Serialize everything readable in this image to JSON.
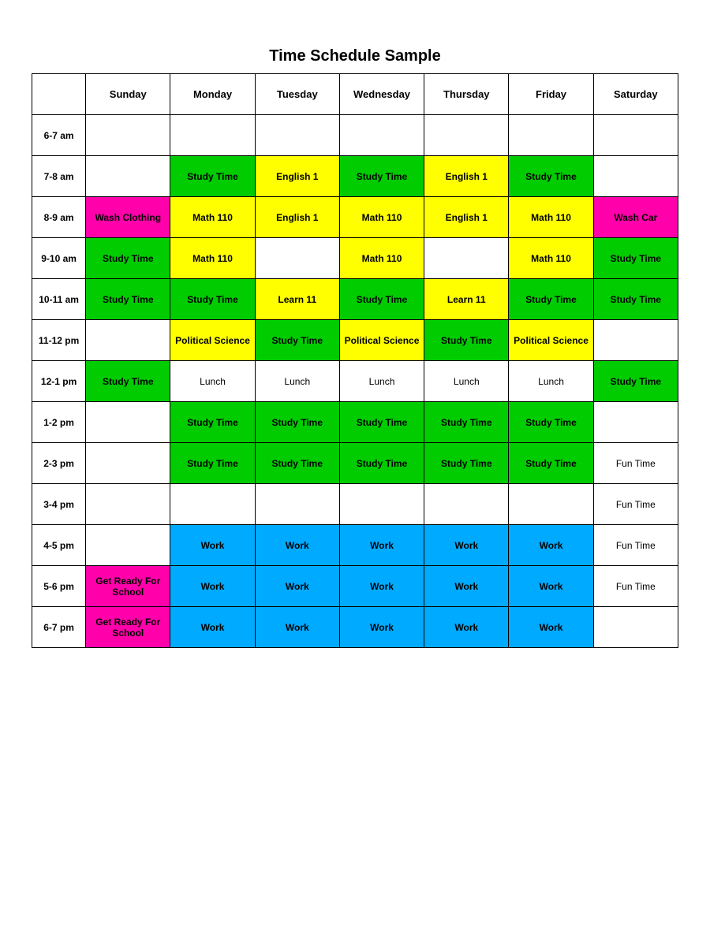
{
  "title": "Time Schedule Sample",
  "headers": [
    "",
    "Sunday",
    "Monday",
    "Tuesday",
    "Wednesday",
    "Thursday",
    "Friday",
    "Saturday"
  ],
  "rows": [
    {
      "time": "6-7 am",
      "cells": [
        {
          "text": "",
          "class": "empty"
        },
        {
          "text": "",
          "class": "empty"
        },
        {
          "text": "",
          "class": "empty"
        },
        {
          "text": "",
          "class": "empty"
        },
        {
          "text": "",
          "class": "empty"
        },
        {
          "text": "",
          "class": "empty"
        },
        {
          "text": "",
          "class": "empty"
        }
      ]
    },
    {
      "time": "7-8 am",
      "cells": [
        {
          "text": "",
          "class": "empty"
        },
        {
          "text": "Study Time",
          "class": "green"
        },
        {
          "text": "English 1",
          "class": "yellow"
        },
        {
          "text": "Study Time",
          "class": "green"
        },
        {
          "text": "English 1",
          "class": "yellow"
        },
        {
          "text": "Study Time",
          "class": "green"
        },
        {
          "text": "",
          "class": "empty"
        }
      ]
    },
    {
      "time": "8-9 am",
      "cells": [
        {
          "text": "Wash Clothing",
          "class": "pink"
        },
        {
          "text": "Math 110",
          "class": "yellow"
        },
        {
          "text": "English 1",
          "class": "yellow"
        },
        {
          "text": "Math 110",
          "class": "yellow"
        },
        {
          "text": "English 1",
          "class": "yellow"
        },
        {
          "text": "Math 110",
          "class": "yellow"
        },
        {
          "text": "Wash Car",
          "class": "pink"
        }
      ]
    },
    {
      "time": "9-10 am",
      "cells": [
        {
          "text": "Study Time",
          "class": "green"
        },
        {
          "text": "Math 110",
          "class": "yellow"
        },
        {
          "text": "",
          "class": "empty"
        },
        {
          "text": "Math 110",
          "class": "yellow"
        },
        {
          "text": "",
          "class": "empty"
        },
        {
          "text": "Math 110",
          "class": "yellow"
        },
        {
          "text": "Study Time",
          "class": "green"
        }
      ]
    },
    {
      "time": "10-11 am",
      "cells": [
        {
          "text": "Study Time",
          "class": "green"
        },
        {
          "text": "Study Time",
          "class": "green"
        },
        {
          "text": "Learn 11",
          "class": "yellow"
        },
        {
          "text": "Study Time",
          "class": "green"
        },
        {
          "text": "Learn 11",
          "class": "yellow"
        },
        {
          "text": "Study Time",
          "class": "green"
        },
        {
          "text": "Study Time",
          "class": "green"
        }
      ]
    },
    {
      "time": "11-12 pm",
      "cells": [
        {
          "text": "",
          "class": "empty"
        },
        {
          "text": "Political Science",
          "class": "yellow"
        },
        {
          "text": "Study Time",
          "class": "green"
        },
        {
          "text": "Political Science",
          "class": "yellow"
        },
        {
          "text": "Study Time",
          "class": "green"
        },
        {
          "text": "Political Science",
          "class": "yellow"
        },
        {
          "text": "",
          "class": "empty"
        }
      ]
    },
    {
      "time": "12-1 pm",
      "cells": [
        {
          "text": "Study Time",
          "class": "green"
        },
        {
          "text": "Lunch",
          "class": "empty"
        },
        {
          "text": "Lunch",
          "class": "empty"
        },
        {
          "text": "Lunch",
          "class": "empty"
        },
        {
          "text": "Lunch",
          "class": "empty"
        },
        {
          "text": "Lunch",
          "class": "empty"
        },
        {
          "text": "Study Time",
          "class": "green"
        }
      ]
    },
    {
      "time": "1-2 pm",
      "cells": [
        {
          "text": "",
          "class": "empty"
        },
        {
          "text": "Study Time",
          "class": "green"
        },
        {
          "text": "Study Time",
          "class": "green"
        },
        {
          "text": "Study Time",
          "class": "green"
        },
        {
          "text": "Study Time",
          "class": "green"
        },
        {
          "text": "Study Time",
          "class": "green"
        },
        {
          "text": "",
          "class": "empty"
        }
      ]
    },
    {
      "time": "2-3 pm",
      "cells": [
        {
          "text": "",
          "class": "empty"
        },
        {
          "text": "Study Time",
          "class": "green"
        },
        {
          "text": "Study Time",
          "class": "green"
        },
        {
          "text": "Study Time",
          "class": "green"
        },
        {
          "text": "Study Time",
          "class": "green"
        },
        {
          "text": "Study Time",
          "class": "green"
        },
        {
          "text": "Fun Time",
          "class": "empty"
        }
      ]
    },
    {
      "time": "3-4 pm",
      "cells": [
        {
          "text": "",
          "class": "empty"
        },
        {
          "text": "",
          "class": "empty"
        },
        {
          "text": "",
          "class": "empty"
        },
        {
          "text": "",
          "class": "empty"
        },
        {
          "text": "",
          "class": "empty"
        },
        {
          "text": "",
          "class": "empty"
        },
        {
          "text": "Fun Time",
          "class": "empty"
        }
      ]
    },
    {
      "time": "4-5 pm",
      "cells": [
        {
          "text": "",
          "class": "empty"
        },
        {
          "text": "Work",
          "class": "cyan"
        },
        {
          "text": "Work",
          "class": "cyan"
        },
        {
          "text": "Work",
          "class": "cyan"
        },
        {
          "text": "Work",
          "class": "cyan"
        },
        {
          "text": "Work",
          "class": "cyan"
        },
        {
          "text": "Fun Time",
          "class": "empty"
        }
      ]
    },
    {
      "time": "5-6 pm",
      "cells": [
        {
          "text": "Get Ready For School",
          "class": "pink"
        },
        {
          "text": "Work",
          "class": "cyan"
        },
        {
          "text": "Work",
          "class": "cyan"
        },
        {
          "text": "Work",
          "class": "cyan"
        },
        {
          "text": "Work",
          "class": "cyan"
        },
        {
          "text": "Work",
          "class": "cyan"
        },
        {
          "text": "Fun Time",
          "class": "empty"
        }
      ]
    },
    {
      "time": "6-7 pm",
      "cells": [
        {
          "text": "Get Ready For School",
          "class": "pink"
        },
        {
          "text": "Work",
          "class": "cyan"
        },
        {
          "text": "Work",
          "class": "cyan"
        },
        {
          "text": "Work",
          "class": "cyan"
        },
        {
          "text": "Work",
          "class": "cyan"
        },
        {
          "text": "Work",
          "class": "cyan"
        },
        {
          "text": "",
          "class": "empty"
        }
      ]
    }
  ]
}
